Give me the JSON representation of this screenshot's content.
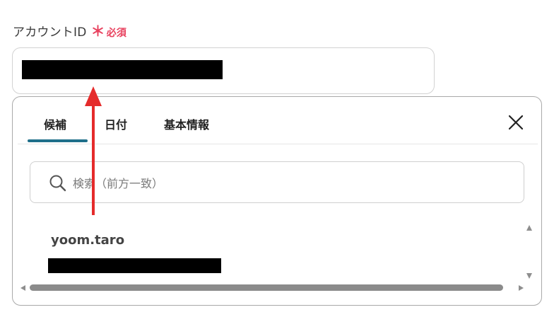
{
  "field": {
    "label": "アカウントID",
    "required_star": "＊",
    "required_text": "必須"
  },
  "tabs": [
    {
      "label": "候補"
    },
    {
      "label": "日付"
    },
    {
      "label": "基本情報"
    }
  ],
  "active_tab": "候補",
  "search": {
    "placeholder": "検索（前方一致）",
    "value": ""
  },
  "candidates": [
    {
      "title": "yoom.taro"
    }
  ],
  "colors": {
    "required": "#e8415e",
    "tab_indicator": "#1f6f8a",
    "annotation_arrow": "#e52b2b"
  },
  "icons": {
    "close": "close-icon",
    "search": "search-icon"
  }
}
